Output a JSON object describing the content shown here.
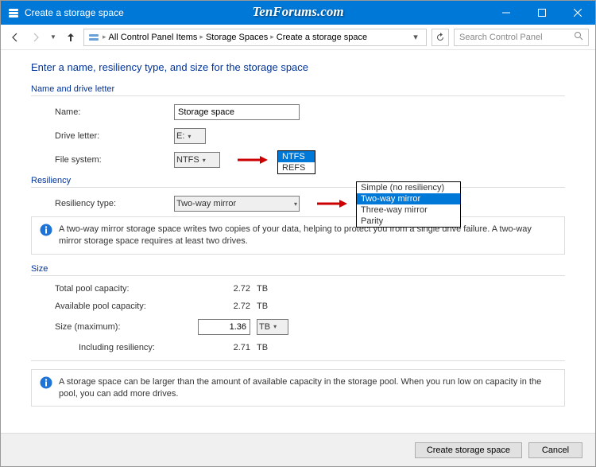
{
  "watermark": "TenForums.com",
  "window": {
    "title": "Create a storage space"
  },
  "toolbar": {
    "breadcrumb": [
      "All Control Panel Items",
      "Storage Spaces",
      "Create a storage space"
    ],
    "search_placeholder": "Search Control Panel"
  },
  "page": {
    "title": "Enter a name, resiliency type, and size for the storage space"
  },
  "sections": {
    "name_drive": {
      "heading": "Name and drive letter",
      "name_label": "Name:",
      "name_value": "Storage space",
      "drive_label": "Drive letter:",
      "drive_value": "E:",
      "fs_label": "File system:",
      "fs_value": "NTFS",
      "fs_options": [
        "NTFS",
        "REFS"
      ],
      "fs_selected_index": 0
    },
    "resiliency": {
      "heading": "Resiliency",
      "type_label": "Resiliency type:",
      "type_value": "Two-way mirror",
      "type_options": [
        "Simple (no resiliency)",
        "Two-way mirror",
        "Three-way mirror",
        "Parity"
      ],
      "type_selected_index": 1,
      "info": "A two-way mirror storage space writes two copies of your data, helping to protect you from a single drive failure. A two-way mirror storage space requires at least two drives."
    },
    "size": {
      "heading": "Size",
      "total_label": "Total pool capacity:",
      "total_value": "2.72",
      "total_unit": "TB",
      "avail_label": "Available pool capacity:",
      "avail_value": "2.72",
      "avail_unit": "TB",
      "max_label": "Size (maximum):",
      "max_value": "1.36",
      "max_unit": "TB",
      "incl_label": "Including resiliency:",
      "incl_value": "2.71",
      "incl_unit": "TB",
      "info": "A storage space can be larger than the amount of available capacity in the storage pool. When you run low on capacity in the pool, you can add more drives."
    }
  },
  "buttons": {
    "create": "Create storage space",
    "cancel": "Cancel"
  }
}
